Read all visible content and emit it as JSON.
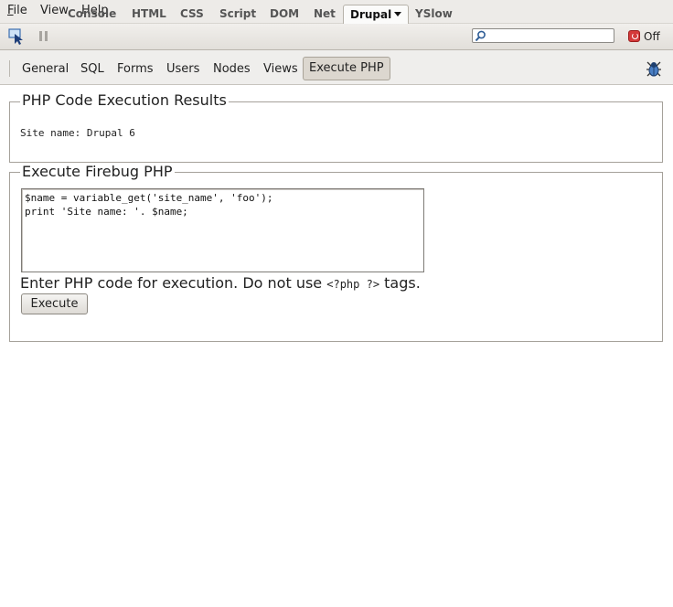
{
  "menubar": {
    "items": [
      {
        "accel": "F",
        "rest": "ile"
      },
      {
        "accel": "",
        "rest": "View"
      },
      {
        "accel": "",
        "rest": "Help"
      }
    ]
  },
  "firebug": {
    "tabs": [
      "Console",
      "HTML",
      "CSS",
      "Script",
      "DOM",
      "Net",
      "Drupal",
      "YSlow"
    ],
    "selected_tab": "Drupal",
    "search_value": "",
    "off_label": "Off"
  },
  "subtoolbar": {
    "items": [
      "General",
      "SQL",
      "Forms",
      "Users",
      "Nodes",
      "Views",
      "Execute PHP"
    ],
    "active": "Execute PHP"
  },
  "results": {
    "legend": "PHP Code Execution Results",
    "output": "Site name: Drupal 6"
  },
  "execute": {
    "legend": "Execute Firebug PHP",
    "code": "$name = variable_get('site_name', 'foo');\nprint 'Site name: '. $name;",
    "help_before": "Enter PHP code for execution. Do not use",
    "help_code": "<?php ?>",
    "help_after": "tags.",
    "button_label": "Execute"
  },
  "colors": {
    "toolbar_bg": "#e2dfda",
    "active_tab_bg": "#dcd7cf",
    "power_off": "#d43a3a"
  }
}
